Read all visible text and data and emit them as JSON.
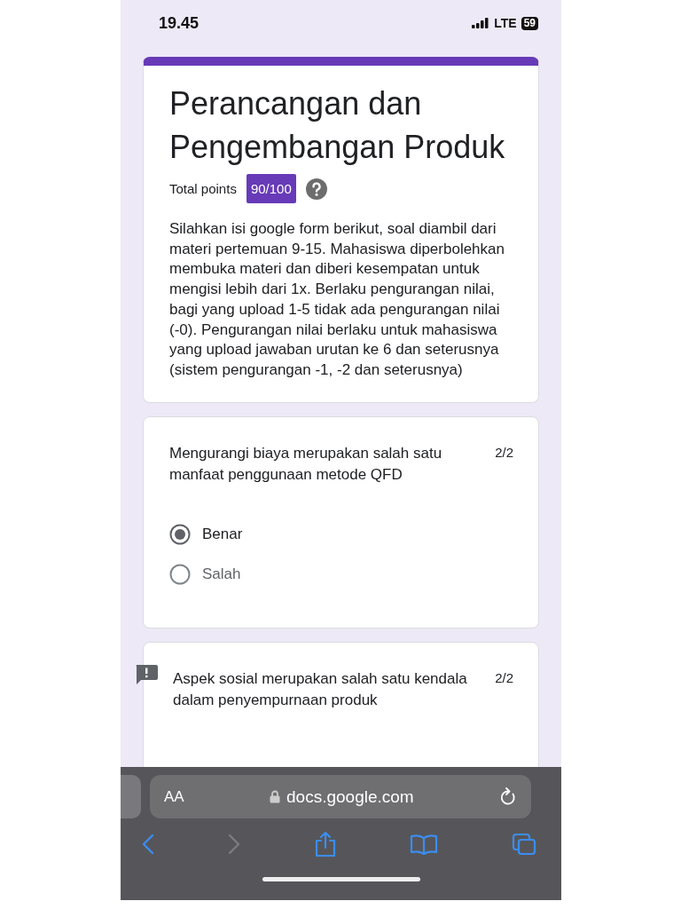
{
  "status_bar": {
    "time": "19.45",
    "network": "LTE",
    "battery": "59"
  },
  "form": {
    "title": "Perancangan dan Pengembangan Produk",
    "total_points_label": "Total points",
    "score": "90/100",
    "description": "Silahkan isi google form berikut, soal diambil dari materi pertemuan 9-15. Mahasiswa diperbolehkan membuka materi dan diberi kesempatan untuk mengisi lebih dari 1x. Berlaku pengurangan nilai, bagi yang upload 1-5 tidak ada pengurangan nilai (-0). Pengurangan nilai berlaku untuk mahasiswa yang upload jawaban urutan ke 6 dan seterusnya (sistem pengurangan -1, -2 dan seterusnya)"
  },
  "questions": [
    {
      "text": "Mengurangi biaya merupakan salah satu manfaat penggunaan metode QFD",
      "points": "2/2",
      "flagged": false,
      "options": [
        {
          "label": "Benar",
          "selected": true
        },
        {
          "label": "Salah",
          "selected": false
        }
      ]
    },
    {
      "text": "Aspek sosial merupakan salah satu kendala dalam penyempurnaan produk",
      "points": "2/2",
      "flagged": true
    }
  ],
  "browser": {
    "text_size": "AA",
    "url": "docs.google.com",
    "back_enabled": true,
    "forward_enabled": false
  }
}
